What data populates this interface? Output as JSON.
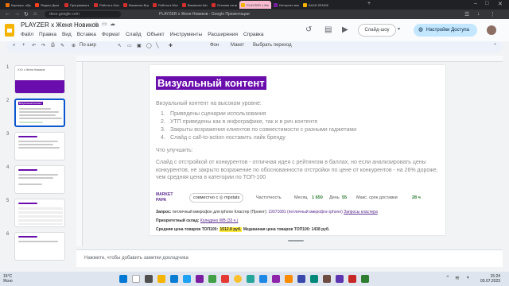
{
  "browser": {
    "tabs": [
      {
        "label": "Карьера, образ"
      },
      {
        "label": "Яндекс Диск"
      },
      {
        "label": "Программа в"
      },
      {
        "label": "Работа в Моск"
      },
      {
        "label": "Вакансия Вид"
      },
      {
        "label": "Работа в Моск"
      },
      {
        "label": "Вакансия Кате"
      },
      {
        "label": "Отклики на ва"
      },
      {
        "label": "PLAYZER x Же",
        "active": true
      },
      {
        "label": "Интернет-маг"
      },
      {
        "label": "БАЗИ ZENDEC"
      }
    ],
    "url": "docs.google.com",
    "window_title": "PLAYZER x Женя Новиков - Google Презентации"
  },
  "app": {
    "title": "PLAYZER x Женя Новиков",
    "menu": [
      "Файл",
      "Правка",
      "Вид",
      "Вставка",
      "Формат",
      "Слайд",
      "Объект",
      "Инструменты",
      "Расширения",
      "Справка"
    ],
    "slideshow_label": "Слайд-шоу",
    "share_label": "Настройки Доступа"
  },
  "toolbar": {
    "zoom_label": "По шир",
    "background_label": "Фон",
    "layout_label": "Макет",
    "transition_label": "Выбрать переход"
  },
  "filmstrip": {
    "slides": [
      {
        "number": "1",
        "title": "XXX x Женя Новиков"
      },
      {
        "number": "2",
        "title": "Визуальный контент"
      },
      {
        "number": "3",
        "title": ""
      },
      {
        "number": "4",
        "title": ""
      },
      {
        "number": "5",
        "title": ""
      },
      {
        "number": "6",
        "title": ""
      }
    ]
  },
  "slide": {
    "title": "Визуальный контент",
    "intro": "Визуальный контент на высоком уровне:",
    "list": [
      {
        "n": "1.",
        "text": "Приведены сценарии использования"
      },
      {
        "n": "2.",
        "text": "УТП приведены как в инфографике, так и в рич контенте"
      },
      {
        "n": "3.",
        "text": "Закрыты возражения клиентов по совместимости с разными гаджетами"
      },
      {
        "n": "4.",
        "text": "Слайд с call-to-action поставить лайк бренду"
      }
    ],
    "improve_heading": "Что улучшить:",
    "improve_text": "Слайд с отстройкой от конкурентов - отличная идея с рейтингом в баллах, но если анализировать цены конкурентов, не закрыто возражение по обоснованности отстройки по цене от конкурентов - на 26% дороже, чем средняя цена в категории по ТОП-100",
    "marketpapa": {
      "logo_line1": "MARKET",
      "logo_line2": "PAPA",
      "collab": "совместно с ◎ mpstats",
      "competition_label": "Частотность",
      "month_label": "Месяц",
      "month_value": "1 650",
      "day_label": "День",
      "day_value": "55",
      "delivery_label": "Макс. срок доставки",
      "delivery_value": "28 ч"
    },
    "query_line": {
      "label": "Запрос:",
      "text": "петличный микрофон для iphone Кластер (Проект):",
      "count": "19071681",
      "extra": "(петличный микрофон iphone)",
      "link": "Запросы кластера"
    },
    "warehouse_line": {
      "label": "Приоритетный склад:",
      "link": "Коледино WB (33 ч.)"
    },
    "price_line": {
      "label": "Средняя цена товаров ТОП100:",
      "value": "1512.8 руб.",
      "median_label": "Медианная цена товаров ТОП100:",
      "median_value": "1438 руб."
    }
  },
  "notes": {
    "placeholder": "Нажмите, чтобы добавить заметки докладчика"
  },
  "taskbar": {
    "weather_temp": "15°C",
    "weather_text": "Ясно",
    "time": "15:24",
    "date": "03.07.2023"
  }
}
